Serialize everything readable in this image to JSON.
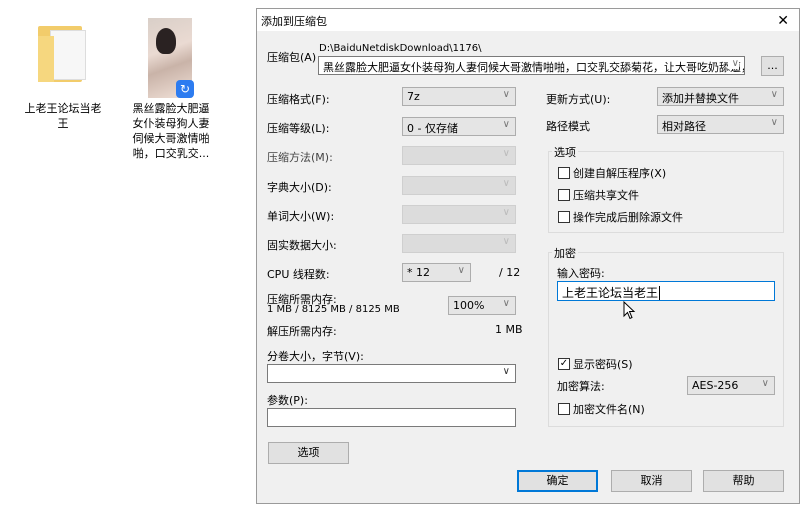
{
  "desktop": {
    "items": [
      {
        "label_lines": [
          "上老王论坛当老",
          "王"
        ],
        "icon": "folder-icon"
      },
      {
        "label_lines": [
          "黑丝露脸大肥逼",
          "女仆装母狗人妻",
          "伺候大哥激情啪",
          "啪，口交乳交..."
        ],
        "icon": "video-file-icon"
      }
    ]
  },
  "dialog": {
    "title": "添加到压缩包",
    "archive_label": "压缩包(A)",
    "archive_path": "D:\\BaiduNetdiskDownload\\1176\\",
    "archive_name": "黑丝露脸大肥逼女仆装母狗人妻伺候大哥激情啪啪，口交乳交舔菊花，让大哥吃奶舔逼，",
    "browse_label": "...",
    "left": {
      "format_label": "压缩格式(F):",
      "format_value": "7z",
      "level_label": "压缩等级(L):",
      "level_value": "0 - 仅存储",
      "method_label": "压缩方法(M):",
      "dict_label": "字典大小(D):",
      "word_label": "单词大小(W):",
      "solid_label": "固实数据大小:",
      "cpu_label": "CPU 线程数:",
      "cpu_value": "* 12",
      "cpu_total": "/ 12",
      "mem_comp_label": "压缩所需内存:",
      "mem_comp_value": "1 MB / 8125 MB / 8125 MB",
      "mem_percent": "100%",
      "mem_decomp_label": "解压所需内存:",
      "mem_decomp_value": "1 MB",
      "split_label": "分卷大小，字节(V):",
      "split_value": "",
      "params_label": "参数(P):",
      "params_value": "",
      "options_button": "选项"
    },
    "right": {
      "update_label": "更新方式(U):",
      "update_value": "添加并替换文件",
      "path_label": "路径模式",
      "path_value": "相对路径",
      "options_group": "选项",
      "options": [
        {
          "label": "创建自解压程序(X)",
          "checked": false
        },
        {
          "label": "压缩共享文件",
          "checked": false
        },
        {
          "label": "操作完成后删除源文件",
          "checked": false
        }
      ],
      "encrypt_group": "加密",
      "password_label": "输入密码:",
      "password_value": "上老王论坛当老王",
      "show_password": {
        "label": "显示密码(S)",
        "checked": true
      },
      "algo_label": "加密算法:",
      "algo_value": "AES-256",
      "encrypt_names": {
        "label": "加密文件名(N)",
        "checked": false
      }
    },
    "buttons": {
      "ok": "确定",
      "cancel": "取消",
      "help": "帮助"
    }
  }
}
